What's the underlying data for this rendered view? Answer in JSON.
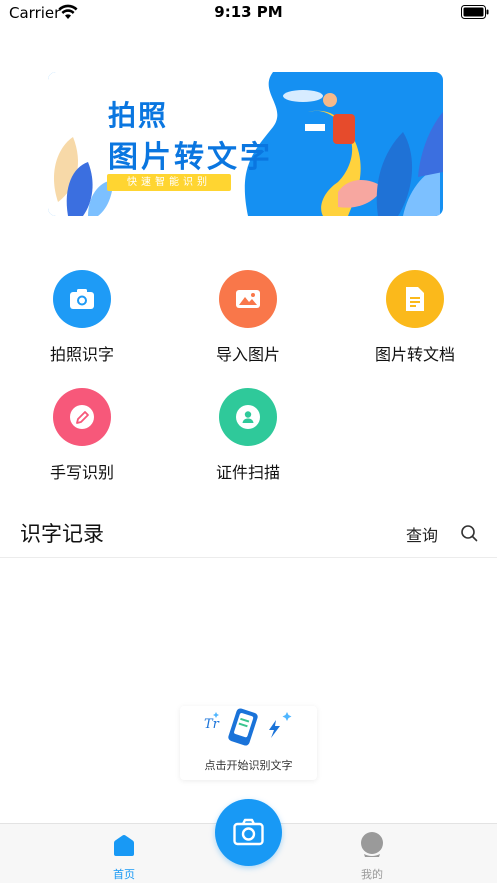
{
  "status_bar": {
    "carrier": "Carrier",
    "time": "9:13 PM"
  },
  "banner": {
    "title_line1": "拍照",
    "title_line2": "图片转文字",
    "tagline": "快速智能识别"
  },
  "features": [
    {
      "label": "拍照识字",
      "icon": "camera-icon",
      "color": "#1e9bf6"
    },
    {
      "label": "导入图片",
      "icon": "image-icon",
      "color": "#f9774a"
    },
    {
      "label": "图片转文档",
      "icon": "document-icon",
      "color": "#fbb91b"
    },
    {
      "label": "手写识别",
      "icon": "pencil-icon",
      "color": "#f7587a"
    },
    {
      "label": "证件扫描",
      "icon": "id-card-icon",
      "color": "#2fc99a"
    }
  ],
  "records": {
    "title": "识字记录",
    "query_label": "查询"
  },
  "hint": {
    "text": "点击开始识别文字"
  },
  "tab_bar": {
    "home_label": "首页",
    "mine_label": "我的",
    "active_color": "#1899f5",
    "inactive_color": "#999999"
  }
}
